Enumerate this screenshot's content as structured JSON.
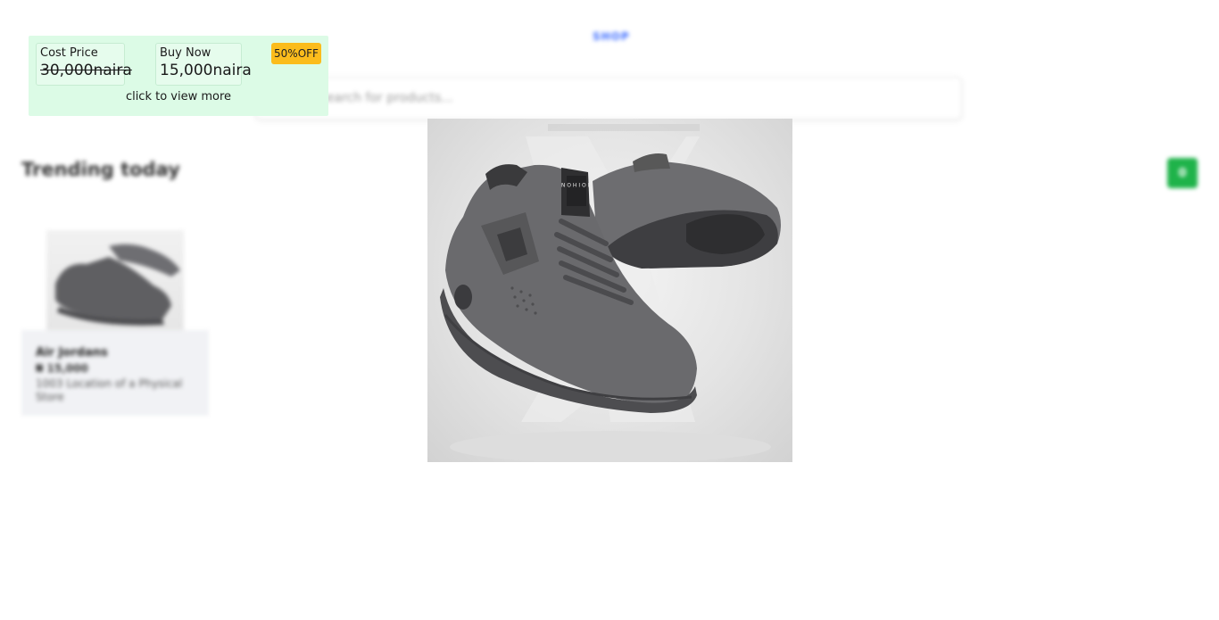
{
  "background": {
    "logo_text": "SHOP",
    "search_placeholder": "Search for products...",
    "section_title": "Trending today",
    "cart_count": "0",
    "trending_card": {
      "name": "Air Jordans",
      "price": "₦ 15,000",
      "location": "1003 Location of a Physical Store"
    }
  },
  "price_panel": {
    "cost_label": "Cost Price",
    "cost_value": "30,000naira",
    "buy_label": "Buy Now",
    "buy_value": "15,000naira",
    "discount": "50%OFF",
    "view_more": "click to view more",
    "colors": {
      "panel_bg": "#dcfbe6",
      "badge_bg": "#fbbc1c"
    }
  },
  "product_image": {
    "subject": "grey suede sneakers",
    "box_text": "N O I H O N"
  }
}
